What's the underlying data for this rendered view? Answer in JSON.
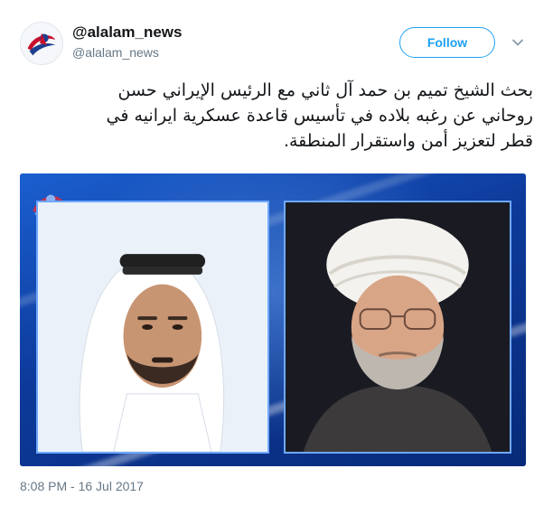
{
  "header": {
    "display_name": "@alalam_news",
    "handle": "@alalam_news",
    "follow_label": "Follow"
  },
  "tweet": {
    "lines": [
      "بحث الشيخ تميم بن حمد آل ثاني مع الرئيس الإيراني حسن",
      "روحاني عن رغبه بلاده في تأسيس قاعدة عسكرية ايرانيه في",
      "قطر لتعزيز أمن واستقرار المنطقة."
    ],
    "timestamp": "8:08 PM - 16 Jul 2017"
  },
  "icons": {
    "avatar": "alalam-logo",
    "caret": "chevron-down-icon"
  },
  "colors": {
    "accent": "#1da1f2",
    "secondary_text": "#657786",
    "media_background": "#0c3f97"
  }
}
